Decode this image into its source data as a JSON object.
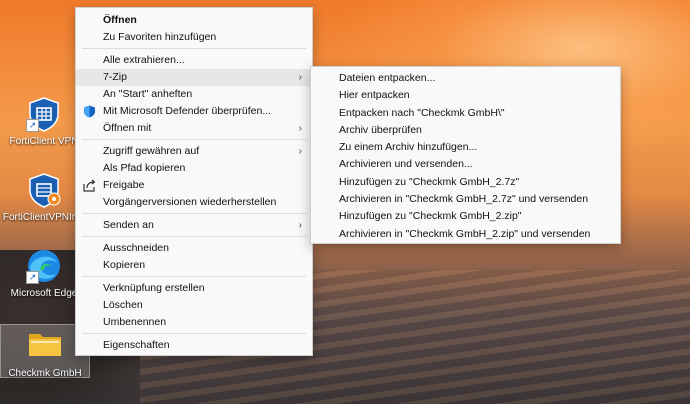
{
  "desktop": {
    "icons": [
      {
        "label": "FortiClient VPN"
      },
      {
        "label": "FortiClientVPNInst"
      },
      {
        "label": "Microsoft Edge"
      },
      {
        "label": "Checkmk GmbH"
      }
    ]
  },
  "context_menu": {
    "items": [
      {
        "label": "Öffnen"
      },
      {
        "label": "Zu Favoriten hinzufügen"
      },
      {
        "label": "Alle extrahieren..."
      },
      {
        "label": "7-Zip"
      },
      {
        "label": "An \"Start\" anheften"
      },
      {
        "label": "Mit Microsoft Defender überprüfen..."
      },
      {
        "label": "Öffnen mit"
      },
      {
        "label": "Zugriff gewähren auf"
      },
      {
        "label": "Als Pfad kopieren"
      },
      {
        "label": "Freigabe"
      },
      {
        "label": "Vorgängerversionen wiederherstellen"
      },
      {
        "label": "Senden an"
      },
      {
        "label": "Ausschneiden"
      },
      {
        "label": "Kopieren"
      },
      {
        "label": "Verknüpfung erstellen"
      },
      {
        "label": "Löschen"
      },
      {
        "label": "Umbenennen"
      },
      {
        "label": "Eigenschaften"
      }
    ],
    "arrow_glyph": "›"
  },
  "submenu_7zip": {
    "items": [
      {
        "label": "Dateien entpacken..."
      },
      {
        "label": "Hier entpacken"
      },
      {
        "label": "Entpacken nach \"Checkmk GmbH\\\""
      },
      {
        "label": "Archiv überprüfen"
      },
      {
        "label": "Zu einem Archiv hinzufügen..."
      },
      {
        "label": "Archivieren und versenden..."
      },
      {
        "label": "Hinzufügen zu \"Checkmk GmbH_2.7z\""
      },
      {
        "label": "Archivieren in \"Checkmk GmbH_2.7z\" und versenden"
      },
      {
        "label": "Hinzufügen zu \"Checkmk GmbH_2.zip\""
      },
      {
        "label": "Archivieren in \"Checkmk GmbH_2.zip\" und versenden"
      }
    ]
  },
  "colors": {
    "menu_bg": "#f9f9f9",
    "highlight": "#e7e7e7",
    "defender_blue": "#1565c0",
    "forticlient_blue": "#1a5fb4",
    "folder_yellow": "#f5c542"
  }
}
